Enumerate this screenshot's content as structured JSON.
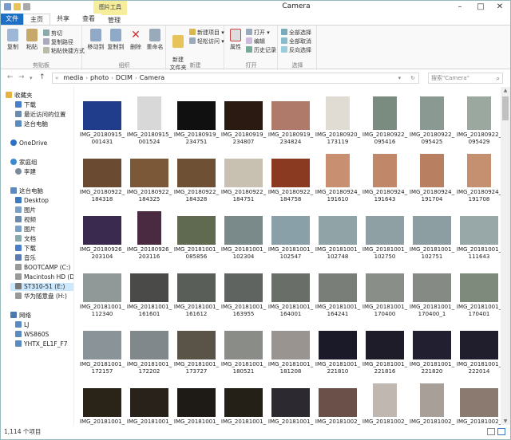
{
  "window": {
    "title": "Camera",
    "context_tab": "图片工具",
    "controls": [
      "–",
      "□",
      "✕"
    ]
  },
  "tabs": [
    "文件",
    "主页",
    "共享",
    "查看",
    "管理"
  ],
  "ribbon": {
    "clipboard": {
      "label": "剪贴板",
      "copy": "复制",
      "paste": "粘贴",
      "cut": "剪切",
      "copy_path": "复制路径",
      "paste_shortcut": "粘贴快捷方式"
    },
    "organize": {
      "label": "组织",
      "move_to": "移动到",
      "copy_to": "复制到",
      "delete": "删除",
      "rename": "重命名"
    },
    "new": {
      "label": "新建",
      "new_folder": "新建\n文件夹",
      "new_item": "新建项目 ▾",
      "easy_access": "轻松访问 ▾"
    },
    "open": {
      "label": "打开",
      "properties": "属性",
      "open": "打开 ▾",
      "edit": "编辑",
      "history": "历史记录"
    },
    "select": {
      "label": "选择",
      "select_all": "全部选择",
      "select_none": "全部取消",
      "invert": "反向选择"
    }
  },
  "address": {
    "crumbs": [
      "media",
      "photo",
      "DCIM",
      "Camera"
    ],
    "search_placeholder": "搜索\"Camera\""
  },
  "nav": {
    "quick_access": "收藏夹",
    "quick_items": [
      "下载",
      "最近访问的位置",
      "这台电脑"
    ],
    "onedrive": "OneDrive",
    "homegroup": "家庭组",
    "homegroup_user": "李建",
    "this_pc": "这台电脑",
    "pc_items": [
      "Desktop",
      "图片",
      "视频",
      "图片",
      "文档",
      "下载",
      "音乐",
      "BOOTCAMP (C:)",
      "Macintosh HD (D:)",
      "ST310-51 (E:)",
      "华为随意盘 (H:)"
    ],
    "network": "网络",
    "network_items": [
      "LJ",
      "WS860S",
      "YHTX_EL1F_F7"
    ]
  },
  "files": [
    {
      "name": "IMG_20180915_001431",
      "color": "#1f3d8a"
    },
    {
      "name": "IMG_20180915_001524",
      "color": "#d8d8d8"
    },
    {
      "name": "IMG_20180919_234751",
      "color": "#101010"
    },
    {
      "name": "IMG_20180919_234807",
      "color": "#2a1a12"
    },
    {
      "name": "IMG_20180919_234824",
      "color": "#b07a6a"
    },
    {
      "name": "IMG_20180920_173119",
      "color": "#e0dcd4"
    },
    {
      "name": "IMG_20180922_095416",
      "color": "#7a8c80"
    },
    {
      "name": "IMG_20180922_095425",
      "color": "#8a9a92"
    },
    {
      "name": "IMG_20180922_095429",
      "color": "#9aa8a0"
    },
    {
      "name": "IMG_20180922_184318",
      "color": "#6a4a30"
    },
    {
      "name": "IMG_20180922_184325",
      "color": "#7a5838"
    },
    {
      "name": "IMG_20180922_184328",
      "color": "#6e5034"
    },
    {
      "name": "IMG_20180922_184751",
      "color": "#c8c0b0"
    },
    {
      "name": "IMG_20180922_184758",
      "color": "#8a3a20"
    },
    {
      "name": "IMG_20180924_191610",
      "color": "#c89070"
    },
    {
      "name": "IMG_20180924_191643",
      "color": "#c08868"
    },
    {
      "name": "IMG_20180924_191704",
      "color": "#b88060"
    },
    {
      "name": "IMG_20180924_191708",
      "color": "#c49070"
    },
    {
      "name": "IMG_20180926_203104",
      "color": "#3a2a50"
    },
    {
      "name": "IMG_20180926_203116",
      "color": "#4a2a40"
    },
    {
      "name": "IMG_20181001_085856",
      "color": "#606a50"
    },
    {
      "name": "IMG_20181001_102304",
      "color": "#7a8a8a"
    },
    {
      "name": "IMG_20181001_102547",
      "color": "#8aa0a8"
    },
    {
      "name": "IMG_20181001_102748",
      "color": "#90a4a8"
    },
    {
      "name": "IMG_20181001_102750",
      "color": "#8ea0a4"
    },
    {
      "name": "IMG_20181001_102751",
      "color": "#8c9ea2"
    },
    {
      "name": "IMG_20181001_111643",
      "color": "#98a8a8"
    },
    {
      "name": "IMG_20181001_112340",
      "color": "#909898"
    },
    {
      "name": "IMG_20181001_161601",
      "color": "#4a4a48"
    },
    {
      "name": "IMG_20181001_161612",
      "color": "#5a5e58"
    },
    {
      "name": "IMG_20181001_163955",
      "color": "#606460"
    },
    {
      "name": "IMG_20181001_164001",
      "color": "#6a6e68"
    },
    {
      "name": "IMG_20181001_164241",
      "color": "#7a7e78"
    },
    {
      "name": "IMG_20181001_170400",
      "color": "#8a8e88"
    },
    {
      "name": "IMG_20181001_170400_1",
      "color": "#868a84"
    },
    {
      "name": "IMG_20181001_170401",
      "color": "#7e8a7c"
    },
    {
      "name": "IMG_20181001_172157",
      "color": "#8a9498"
    },
    {
      "name": "IMG_20181001_172202",
      "color": "#80888c"
    },
    {
      "name": "IMG_20181001_173727",
      "color": "#5a5448"
    },
    {
      "name": "IMG_20181001_180521",
      "color": "#8a8c88"
    },
    {
      "name": "IMG_20181001_181208",
      "color": "#9a9490"
    },
    {
      "name": "IMG_20181001_221810",
      "color": "#1a1a28"
    },
    {
      "name": "IMG_20181001_221816",
      "color": "#1e1c28"
    },
    {
      "name": "IMG_20181001_221820",
      "color": "#222030"
    },
    {
      "name": "IMG_20181001_222014",
      "color": "#201e2c"
    },
    {
      "name": "IMG_20181001_",
      "color": "#2a2418"
    },
    {
      "name": "IMG_20181001_",
      "color": "#28221a"
    },
    {
      "name": "IMG_20181001_",
      "color": "#1e1a16"
    },
    {
      "name": "IMG_20181001_",
      "color": "#242018"
    },
    {
      "name": "IMG_20181001_",
      "color": "#2c2a30"
    },
    {
      "name": "IMG_20181002_",
      "color": "#6a5048"
    },
    {
      "name": "IMG_20181002_",
      "color": "#c0b8b0"
    },
    {
      "name": "IMG_20181002_",
      "color": "#a8a098"
    },
    {
      "name": "IMG_20181002_",
      "color": "#8a7a70"
    }
  ],
  "status": {
    "count": "1,114 个项目"
  },
  "colors": {
    "file_tab": "#1c6fc7",
    "context_tab": "#f6ee9c",
    "selected_nav": "#cce8ff"
  }
}
